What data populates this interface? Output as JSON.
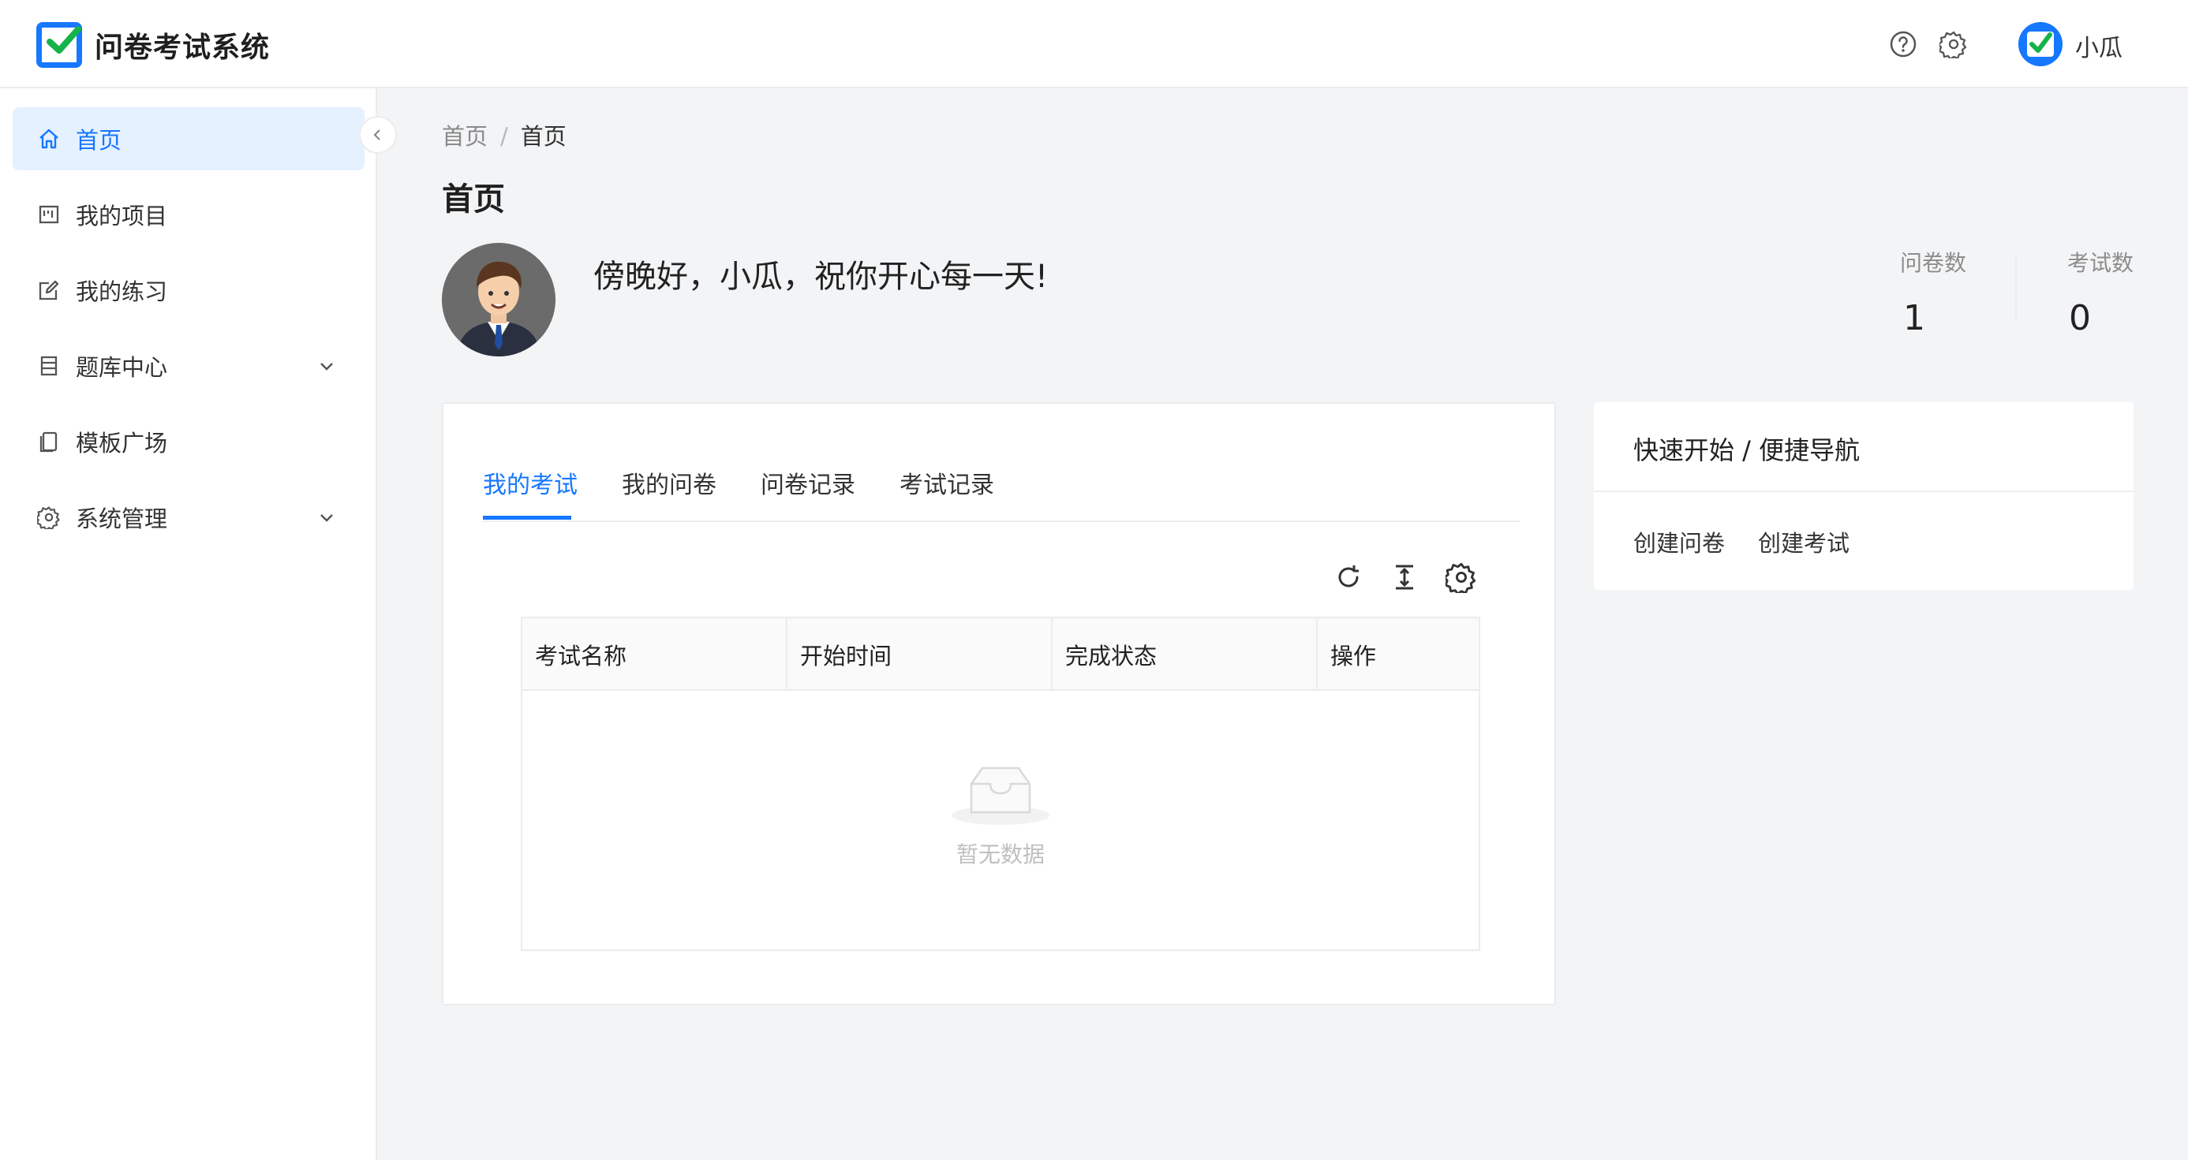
{
  "app": {
    "title": "问卷考试系统",
    "accent": "#1677ff"
  },
  "header": {
    "help_icon": "help-icon",
    "settings_icon": "gear-icon",
    "user_name": "小瓜"
  },
  "sidebar": {
    "items": [
      {
        "label": "首页",
        "icon": "home-icon",
        "active": true
      },
      {
        "label": "我的项目",
        "icon": "project-icon"
      },
      {
        "label": "我的练习",
        "icon": "edit-icon"
      },
      {
        "label": "题库中心",
        "icon": "database-icon",
        "expandable": true
      },
      {
        "label": "模板广场",
        "icon": "template-icon"
      },
      {
        "label": "系统管理",
        "icon": "gear-icon",
        "expandable": true
      }
    ]
  },
  "breadcrumb": {
    "root": "首页",
    "separator": "/",
    "current": "首页"
  },
  "page": {
    "title": "首页",
    "greeting": "傍晚好，小瓜，祝你开心每一天!"
  },
  "stats": [
    {
      "label": "问卷数",
      "value": "1"
    },
    {
      "label": "考试数",
      "value": "0"
    }
  ],
  "main_card": {
    "tabs": [
      "我的考试",
      "我的问卷",
      "问卷记录",
      "考试记录"
    ],
    "active_tab": 0,
    "tools": [
      "refresh-icon",
      "column-height-icon",
      "settings-icon"
    ],
    "columns": [
      "考试名称",
      "开始时间",
      "完成状态",
      "操作"
    ],
    "empty_text": "暂无数据"
  },
  "quick_card": {
    "title": "快速开始 / 便捷导航",
    "links": [
      "创建问卷",
      "创建考试"
    ]
  }
}
